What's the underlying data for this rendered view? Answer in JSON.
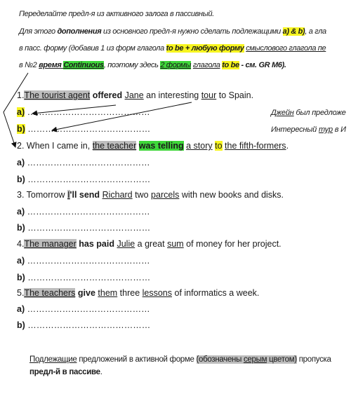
{
  "header": [
    [
      {
        "t": "Переделайте предл-я из активного залога в пассивный."
      }
    ],
    [
      {
        "t": "Для этого "
      },
      {
        "t": "дополнения",
        "b": 1
      },
      {
        "t": " из основного предл-я нужно сделать подлежащими "
      },
      {
        "t": "a) & b)",
        "b": 1,
        "hl": "yellow"
      },
      {
        "t": ", а гла"
      }
    ],
    [
      {
        "t": "в пасс. форму (добавив 1 из форм глагола "
      },
      {
        "t": "to be + любую форму",
        "b": 1,
        "hl": "yellow"
      },
      {
        "t": " "
      },
      {
        "t": "смыслового глагола пе",
        "u": 1
      }
    ],
    [
      {
        "t": "в №2 "
      },
      {
        "t": "время ",
        "b": 1,
        "u": 1
      },
      {
        "t": "Continuous",
        "b": 1,
        "u": 1,
        "hl": "green"
      },
      {
        "t": ", поэтому здесь "
      },
      {
        "t": "2 формы",
        "u": 1,
        "hl": "green"
      },
      {
        "t": " "
      },
      {
        "t": "глагола",
        "u": 1
      },
      {
        "t": " "
      },
      {
        "t": "to be",
        "b": 1,
        "hl": "yellow"
      },
      {
        "t": " - см. GR M6).",
        "b": 1
      }
    ]
  ],
  "exercises": [
    [
      {
        "t": "1."
      },
      {
        "t": "The tourist agent",
        "u": 1,
        "hl": "gray"
      },
      {
        "t": " "
      },
      {
        "t": "offered",
        "b": 1
      },
      {
        "t": " "
      },
      {
        "t": "Jane",
        "u": 1
      },
      {
        "t": " an interesting "
      },
      {
        "t": "tour",
        "u": 1
      },
      {
        "t": " to Spain."
      }
    ],
    [
      {
        "t": "a)",
        "b": 1,
        "hl": "yellow"
      },
      {
        "t": " ……………………………………"
      }
    ],
    [
      {
        "t": "b)",
        "b": 1,
        "hl": "yellow"
      },
      {
        "t": " ……………………………………"
      }
    ],
    [
      {
        "t": "2. When I came in, "
      },
      {
        "t": "the teacher",
        "u": 1,
        "hl": "gray"
      },
      {
        "t": " "
      },
      {
        "t": "was telling",
        "b": 1,
        "hl": "green"
      },
      {
        "t": " "
      },
      {
        "t": "a story",
        "u": 1
      },
      {
        "t": " "
      },
      {
        "t": "to",
        "hl": "yellow"
      },
      {
        "t": " "
      },
      {
        "t": "the fifth-formers",
        "u": 1
      },
      {
        "t": "."
      }
    ],
    [
      {
        "t": "a)",
        "b": 1
      },
      {
        "t": " ……………………………………"
      }
    ],
    [
      {
        "t": "b)",
        "b": 1
      },
      {
        "t": " ……………………………………"
      }
    ],
    [
      {
        "t": "3. Tomorrow "
      },
      {
        "t": "I",
        "u": 1,
        "hl": "gray"
      },
      {
        "t": "'ll send",
        "b": 1
      },
      {
        "t": " "
      },
      {
        "t": "Richard",
        "u": 1
      },
      {
        "t": " two "
      },
      {
        "t": "parcels",
        "u": 1
      },
      {
        "t": " with new books and disks."
      }
    ],
    [
      {
        "t": "a)",
        "b": 1
      },
      {
        "t": " ……………………………………"
      }
    ],
    [
      {
        "t": "b)",
        "b": 1
      },
      {
        "t": " ……………………………………"
      }
    ],
    [
      {
        "t": "4."
      },
      {
        "t": "The manager",
        "u": 1,
        "hl": "gray"
      },
      {
        "t": " "
      },
      {
        "t": "has paid",
        "b": 1
      },
      {
        "t": " "
      },
      {
        "t": "Julie",
        "u": 1
      },
      {
        "t": " a great "
      },
      {
        "t": "sum",
        "u": 1
      },
      {
        "t": " of money for her project."
      }
    ],
    [
      {
        "t": "a)",
        "b": 1
      },
      {
        "t": " ……………………………………"
      }
    ],
    [
      {
        "t": "b)",
        "b": 1
      },
      {
        "t": " ……………………………………"
      }
    ],
    [
      {
        "t": "5."
      },
      {
        "t": "The teachers",
        "u": 1,
        "hl": "gray"
      },
      {
        "t": " "
      },
      {
        "t": "give",
        "b": 1
      },
      {
        "t": " "
      },
      {
        "t": "them",
        "u": 1
      },
      {
        "t": " three "
      },
      {
        "t": "lessons",
        "u": 1
      },
      {
        "t": " of informatics a week."
      }
    ],
    [
      {
        "t": "a)",
        "b": 1
      },
      {
        "t": " ……………………………………"
      }
    ],
    [
      {
        "t": "b)",
        "b": 1
      },
      {
        "t": " ……………………………………"
      }
    ]
  ],
  "side_notes": [
    [
      {
        "t": "Джейн",
        "u": 1
      },
      {
        "t": " был предложе"
      }
    ],
    [
      {
        "t": "Интересный "
      },
      {
        "t": "тур",
        "u": 1
      },
      {
        "t": " в И"
      }
    ]
  ],
  "footer": [
    [
      {
        "t": "Подлежащие",
        "u": 1
      },
      {
        "t": " предложений в активной форме "
      },
      {
        "t": "(обозначены ",
        "hl": "gray"
      },
      {
        "t": "серым",
        "u": 1,
        "hl": "gray"
      },
      {
        "t": " цветом)",
        "hl": "gray"
      },
      {
        "t": " пропуска"
      }
    ],
    [
      {
        "t": "предл-й в пассиве",
        "b": 1
      },
      {
        "t": "."
      }
    ]
  ],
  "colors": {
    "yellow": "#f7f51f",
    "green": "#3fd73a",
    "gray": "#bdbdbd"
  }
}
